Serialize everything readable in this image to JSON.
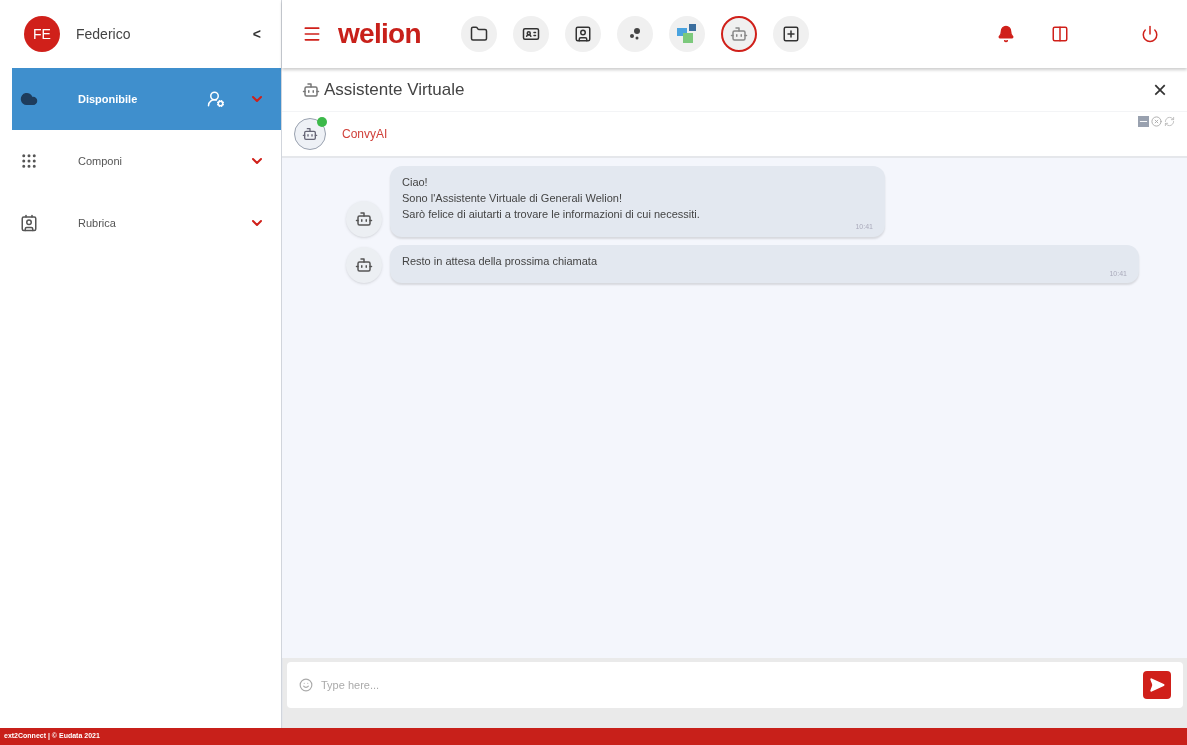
{
  "user": {
    "initials": "FE",
    "name": "Federico",
    "collapse": "<"
  },
  "sidebar": {
    "items": [
      {
        "kind": "status",
        "label": "Disponibile",
        "selected": true
      },
      {
        "kind": "dialpad",
        "label": "Componi",
        "selected": false
      },
      {
        "kind": "contacts",
        "label": "Rubrica",
        "selected": false
      }
    ]
  },
  "header": {
    "logo": "welion",
    "toolbar": [
      {
        "kind": "folder",
        "selected": false
      },
      {
        "kind": "card",
        "selected": false
      },
      {
        "kind": "badge",
        "selected": false
      },
      {
        "kind": "dots",
        "selected": false
      },
      {
        "kind": "squares",
        "selected": false
      },
      {
        "kind": "robot",
        "selected": true
      },
      {
        "kind": "plus",
        "selected": false
      }
    ]
  },
  "panel": {
    "title": "Assistente Virtuale",
    "close": "×",
    "agent": {
      "name": "ConvyAI",
      "online": true
    }
  },
  "messages": [
    {
      "lines": [
        "Ciao!",
        "Sono l'Assistente Virtuale di Generali Welion!",
        "Sarò felice di aiutarti a trovare le informazioni di cui necessiti."
      ],
      "time": "10:41"
    },
    {
      "lines": [
        "Resto in attesa della prossima chiamata"
      ],
      "time": "10:41"
    }
  ],
  "composer": {
    "placeholder": "Type here..."
  },
  "footer": "ext2Connect | © Eudata 2021"
}
